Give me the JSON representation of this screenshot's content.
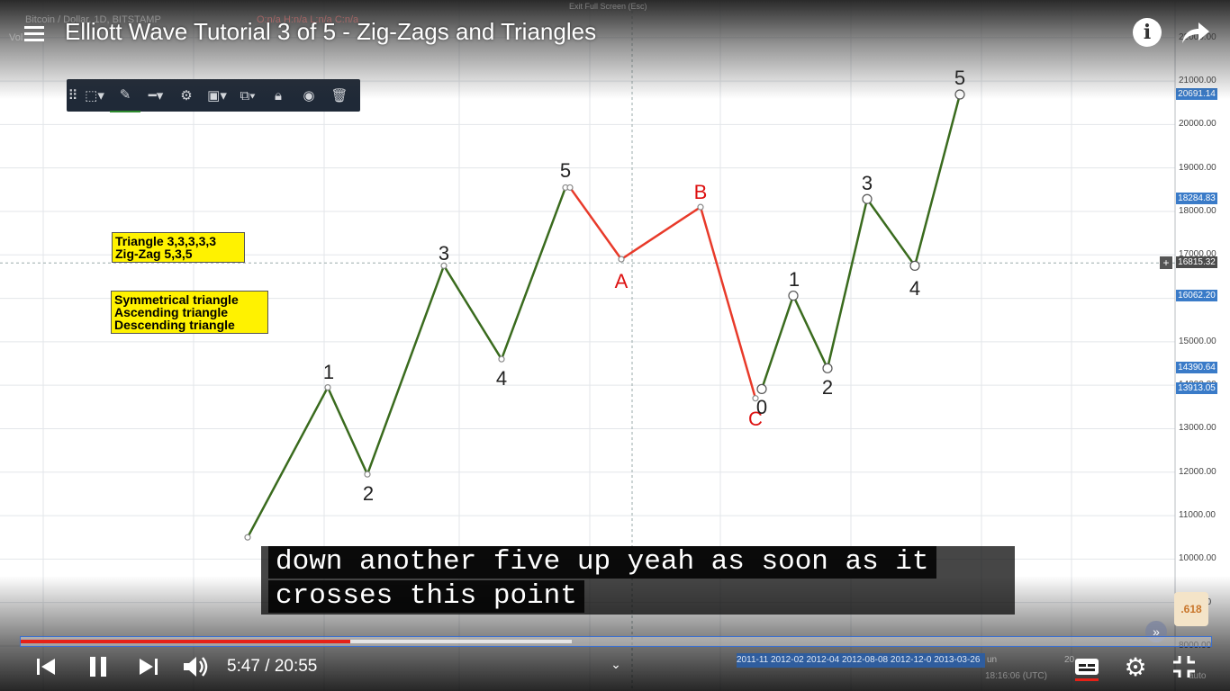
{
  "video": {
    "title": "Elliott Wave Tutorial 3 of 5 - Zig-Zags and Triangles",
    "time": "5:47 / 20:55",
    "progress_played_fraction": 0.277,
    "progress_buffered_fraction": 0.463,
    "caption_line1": "down another five up yeah as soon as it",
    "caption_line2": "crosses this point",
    "accent_color": "#e62117",
    "controls": [
      "previous-icon",
      "pause-icon",
      "next-icon",
      "volume-icon",
      "subtitles-icon",
      "settings-icon",
      "exit-fullscreen-icon"
    ],
    "top_icons": [
      "menu-icon",
      "info-icon",
      "share-icon"
    ]
  },
  "chart_header": {
    "symbol": "Bitcoin / Dollar, 1D, BITSTAMP",
    "ohlc": "O:n/a H:n/a L:n/a C:n/a",
    "vol": "Vol",
    "exit_fullscreen": "Exit Full Screen (Esc)"
  },
  "annotations": {
    "box1_line1": "Triangle 3,3,3,3,3",
    "box1_line2": "Zig-Zag 5,3,5",
    "box2_line1": "Symmetrical triangle",
    "box2_line2": "Ascending triangle",
    "box2_line3": "Descending triangle"
  },
  "price_axis": {
    "ticks": [
      "22000.00",
      "21000.00",
      "20000.00",
      "19000.00",
      "18000.00",
      "17000.00",
      "16000.00",
      "15000.00",
      "14000.00",
      "13000.00",
      "12000.00",
      "11000.00",
      "10000.00",
      "9000.00",
      "8000.00"
    ],
    "badges": [
      "20691.14",
      "18284.83",
      "16815.32",
      "16062.20",
      "14390.64",
      "13913.05"
    ],
    "crosshair_plus": "+",
    "fib_badge": ".618"
  },
  "date_axis": {
    "labels": "2011-11 2012-02 2012-04 2012-08-08 2012-12-0 2013-03-26",
    "clock": "18:16:06 (UTC)",
    "auto_label": "auto",
    "year_label": "20",
    "jun_label": "un"
  },
  "chart_data": {
    "type": "line",
    "y_unit": "USD",
    "series": [
      {
        "color": "#3a6b1e",
        "waves": [
          {
            "label": "",
            "y": 10500
          },
          {
            "label": "1",
            "y": 13950
          },
          {
            "label": "2",
            "y": 11950
          },
          {
            "label": "3",
            "y": 16750
          },
          {
            "label": "4",
            "y": 14600
          },
          {
            "label": "5",
            "y": 18550
          }
        ]
      },
      {
        "color": "#e83a2a",
        "waves": [
          {
            "label": "5",
            "y": 18550
          },
          {
            "label": "A",
            "y": 16900
          },
          {
            "label": "B",
            "y": 18100
          },
          {
            "label": "C",
            "y": 13700
          }
        ]
      },
      {
        "color": "#3a6b1e",
        "waves": [
          {
            "label": "0",
            "y": 13913.05
          },
          {
            "label": "1",
            "y": 16062.2
          },
          {
            "label": "2",
            "y": 14390.64
          },
          {
            "label": "3",
            "y": 18284.83
          },
          {
            "label": "4",
            "y": 16750
          },
          {
            "label": "5",
            "y": 20691.14
          }
        ]
      }
    ],
    "ylim": [
      7700,
      22600
    ],
    "grid": true
  }
}
